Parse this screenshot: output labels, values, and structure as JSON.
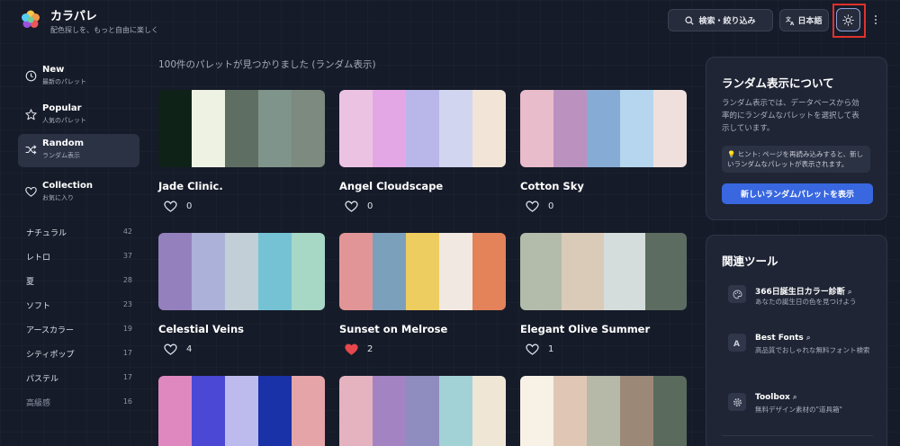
{
  "header": {
    "title": "カラパレ",
    "subtitle": "配色探しを、もっと自由に楽しく",
    "search_label": "検索・絞り込み",
    "lang_label": "日本語"
  },
  "sidebar": {
    "nav": [
      {
        "label": "New",
        "sub": "最新のパレット",
        "icon": "clock-icon"
      },
      {
        "label": "Popular",
        "sub": "人気のパレット",
        "icon": "star-icon"
      },
      {
        "label": "Random",
        "sub": "ランダム表示",
        "icon": "shuffle-icon",
        "active": true
      },
      {
        "label": "Collection",
        "sub": "お気に入り",
        "icon": "heart-icon"
      }
    ],
    "tags": [
      {
        "label": "ナチュラル",
        "count": "42"
      },
      {
        "label": "レトロ",
        "count": "37"
      },
      {
        "label": "夏",
        "count": "28"
      },
      {
        "label": "ソフト",
        "count": "23"
      },
      {
        "label": "アースカラー",
        "count": "19"
      },
      {
        "label": "シティポップ",
        "count": "17"
      },
      {
        "label": "パステル",
        "count": "17"
      },
      {
        "label": "高級感",
        "count": "16"
      }
    ]
  },
  "main": {
    "result_count": "100件のパレットが見つかりました (ランダム表示)",
    "palettes": [
      {
        "name": "Jade Clinic.",
        "likes": "0",
        "liked": false,
        "colors": [
          "#0f2218",
          "#eef2e3",
          "#5f6e62",
          "#7f948a",
          "#7d8a7f"
        ]
      },
      {
        "name": "Angel Cloudscape",
        "likes": "0",
        "liked": false,
        "colors": [
          "#ecc2e2",
          "#e4a7e6",
          "#b9b6ea",
          "#d2d5f0",
          "#f2e5d7"
        ]
      },
      {
        "name": "Cotton Sky",
        "likes": "0",
        "liked": false,
        "colors": [
          "#e8bccb",
          "#bb92bf",
          "#86acd6",
          "#b5d6ee",
          "#efe0de"
        ]
      },
      {
        "name": "Celestial Veins",
        "likes": "4",
        "liked": false,
        "colors": [
          "#9580be",
          "#acb1d9",
          "#c2cfd6",
          "#76c2d5",
          "#a7d7c5"
        ]
      },
      {
        "name": "Sunset on Melrose",
        "likes": "2",
        "liked": true,
        "colors": [
          "#e29596",
          "#7ba0bc",
          "#edcd5f",
          "#f1e9e1",
          "#e4825a"
        ]
      },
      {
        "name": "Elegant Olive Summer",
        "likes": "1",
        "liked": false,
        "colors": [
          "#b3bcaa",
          "#dacbb9",
          "#d4dddb",
          "#5c6c61"
        ]
      },
      {
        "name": "",
        "likes": "",
        "liked": false,
        "colors": [
          "#de88bf",
          "#4a48d4",
          "#bdbbee",
          "#1a32a8",
          "#e5a4a7"
        ]
      },
      {
        "name": "",
        "likes": "",
        "liked": false,
        "colors": [
          "#e5b3bf",
          "#a383c1",
          "#8f8cbf",
          "#a3d2d6",
          "#f0e6d5"
        ]
      },
      {
        "name": "",
        "likes": "",
        "liked": false,
        "colors": [
          "#f8f1e6",
          "#e0c7b5",
          "#b6b8a8",
          "#9c8877",
          "#5a6a5d"
        ]
      }
    ]
  },
  "about": {
    "title": "ランダム表示について",
    "desc": "ランダム表示では、データベースから効率的にランダムなパレットを選択して表示しています。",
    "hint": "💡 ヒント: ページを再読み込みすると、新しいランダムなパレットが表示されます。",
    "button": "新しいランダムパレットを表示"
  },
  "tools": {
    "title": "関連ツール",
    "items": [
      {
        "name": "366日誕生日カラー診断",
        "desc": "あなたの誕生日の色を見つけよう",
        "icon": "palette-icon"
      },
      {
        "name": "Best Fonts",
        "desc": "高品質でおしゃれな無料フォント検索",
        "icon": "font-icon"
      },
      {
        "name": "Toolbox",
        "desc": "無料デザイン素材の\"道具箱\"",
        "icon": "gear-icon"
      }
    ]
  },
  "colors": {
    "accent": "#3867e0",
    "liked_heart": "#e5484d",
    "highlight": "#e0312a"
  }
}
